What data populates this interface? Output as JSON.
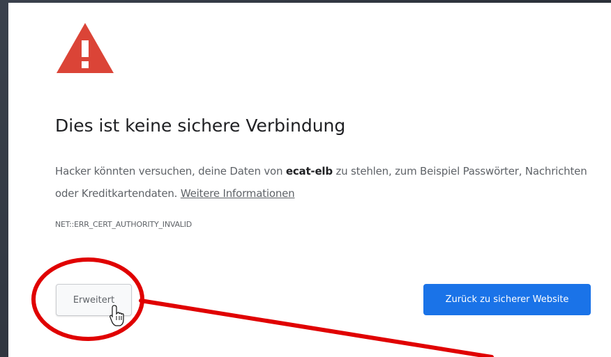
{
  "interstitial": {
    "title": "Dies ist keine sichere Verbindung",
    "desc_before": "Hacker könnten versuchen, deine Daten von ",
    "desc_host": "ecat-elb",
    "desc_after": " zu stehlen, zum Beispiel Passwörter, Nachrichten oder Kreditkartendaten. ",
    "more_info_link": "Weitere Informationen",
    "error_code": "NET::ERR_CERT_AUTHORITY_INVALID",
    "advanced_button": "Erweitert",
    "back_button": "Zurück zu sicherer Website"
  },
  "icons": {
    "warning": "warning-triangle-icon",
    "cursor": "hand-pointer-cursor-icon"
  },
  "annotation": {
    "highlight_shape": "circle",
    "pointer_shape": "arrow-line"
  },
  "colors": {
    "warning_red": "#db4437",
    "primary_button": "#1a73e8",
    "annotation_red": "#e00000",
    "text_primary": "#202124",
    "text_secondary": "#5f6368"
  }
}
